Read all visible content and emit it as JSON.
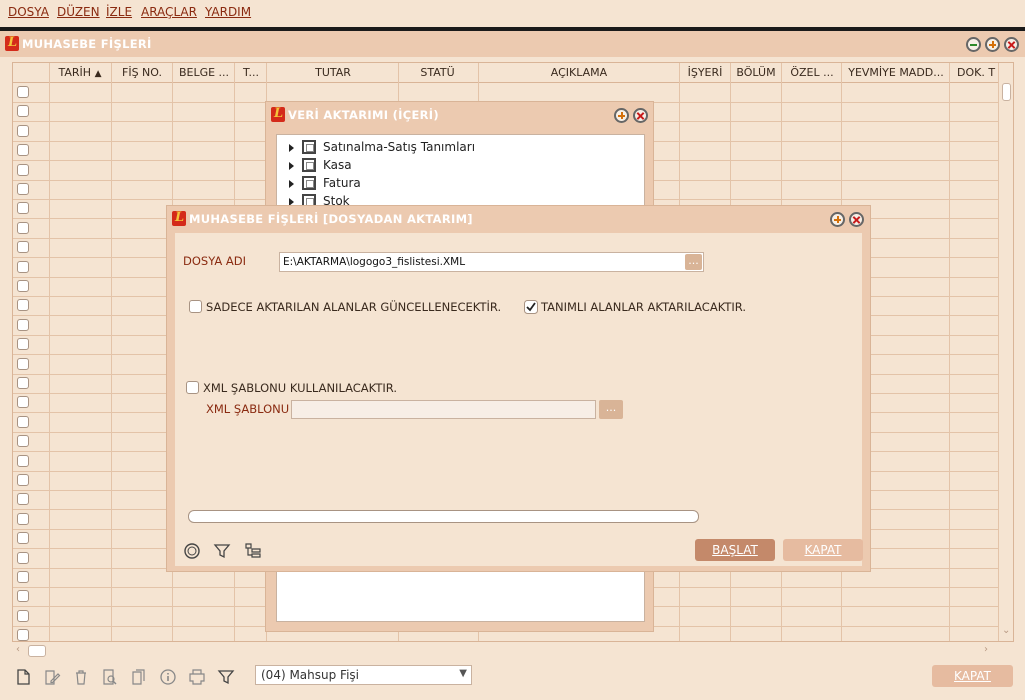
{
  "menu": [
    "DOSYA",
    "DÜZEN",
    "İZLE",
    "ARAÇLAR",
    "YARDIM"
  ],
  "main_window": {
    "title": "MUHASEBE FİŞLERİ"
  },
  "grid": {
    "columns": [
      "TARİH",
      "FİŞ NO.",
      "BELGE ...",
      "T...",
      "TUTAR",
      "STATÜ",
      "AÇIKLAMA",
      "İŞYERİ",
      "BÖLÜM",
      "ÖZEL ...",
      "YEVMİYE MADD...",
      "DOK. T"
    ],
    "sort_indicator": "▲"
  },
  "veri_window": {
    "title": "VERİ AKTARIMI (İÇERİ)",
    "tree": [
      "Satınalma-Satış Tanımları",
      "Kasa",
      "Fatura",
      "Stok"
    ]
  },
  "dosya_window": {
    "title": "MUHASEBE FİŞLERİ [DOSYADAN AKTARIM]",
    "file_label": "DOSYA ADI",
    "file_value": "E:\\AKTARMA\\logogo3_fislistesi.XML",
    "browse": "...",
    "only_updated_label": "SADECE AKTARILAN ALANLAR GÜNCELLENECEKTİR.",
    "only_updated_checked": false,
    "defined_fields_label": "TANIMLI ALANLAR AKTARILACAKTIR.",
    "defined_fields_checked": true,
    "xml_template_check_label": "XML ŞABLONU KULLANILACAKTIR.",
    "xml_template_checked": false,
    "xml_template_label": "XML ŞABLONU",
    "xml_template_value": "",
    "start_button": "BAŞLAT",
    "close_button": "KAPAT",
    "progress": 0
  },
  "toolbar": {
    "record_type": "(04) Mahsup Fişi",
    "close_button": "KAPAT"
  },
  "colors": {
    "background": "#f5e4d2",
    "title_bar": "#eccab0",
    "primary_button": "#c4896a",
    "disabled_button": "#e6bba0",
    "label_text": "#8a2a10"
  }
}
